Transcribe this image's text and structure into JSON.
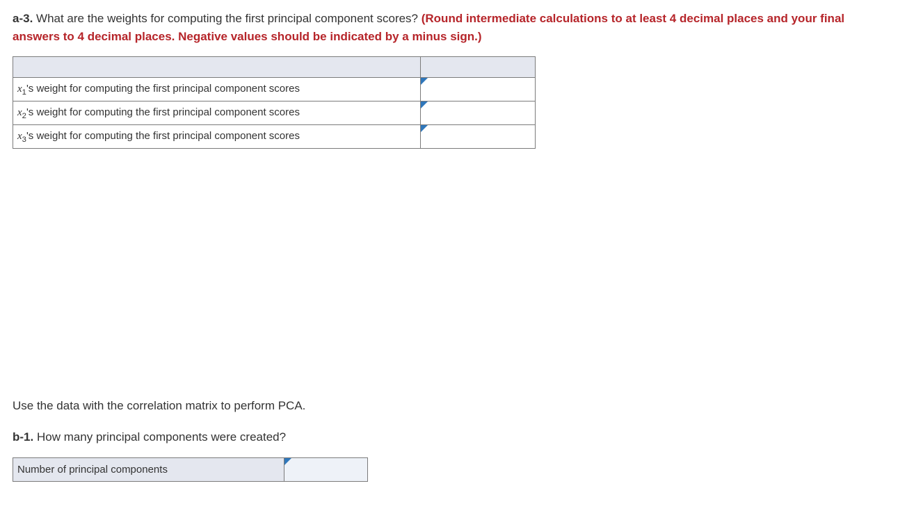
{
  "q_a3": {
    "label": "a-3.",
    "body": " What are the weights for computing the first principal component scores? ",
    "hint": "(Round intermediate calculations to at least 4 decimal places and your final answers to 4 decimal places. Negative values should be indicated by a minus sign.)"
  },
  "table_a3": {
    "rows": [
      {
        "var": "x",
        "sub": "1",
        "rest": "'s weight for computing the first principal component scores"
      },
      {
        "var": "x",
        "sub": "2",
        "rest": "'s weight for computing the first principal component scores"
      },
      {
        "var": "x",
        "sub": "3",
        "rest": "'s weight for computing the first principal component scores"
      }
    ]
  },
  "section_b_intro": "Use the data with the correlation matrix to perform PCA.",
  "q_b1": {
    "label": "b-1.",
    "body": " How many principal components were created?"
  },
  "table_b1": {
    "label": "Number of principal components"
  }
}
